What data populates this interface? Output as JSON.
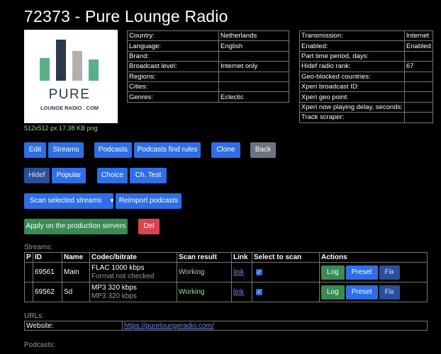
{
  "title": "72373 - Pure Lounge Radio",
  "logo": {
    "word": "PURE",
    "sub": "LOUNGE RADIO . COM",
    "colors": {
      "teal": "#5cae8a",
      "dark": "#2a3a4a",
      "grey": "#b0b0b0"
    },
    "info": "512x512 px 17.38 KB png"
  },
  "info_left": [
    {
      "k": "Country:",
      "v": "Netherlands"
    },
    {
      "k": "Language:",
      "v": "English"
    },
    {
      "k": "Brand:",
      "v": ""
    },
    {
      "k": "Broadcast level:",
      "v": "Internet only"
    },
    {
      "k": "Regions:",
      "v": ""
    },
    {
      "k": "Cities:",
      "v": ""
    },
    {
      "k": "Genres:",
      "v": "Eclectic"
    }
  ],
  "info_right": [
    {
      "k": "Transmission:",
      "v": "Internet"
    },
    {
      "k": "Enabled:",
      "v": "Enabled"
    },
    {
      "k": "Part time period, days:",
      "v": ""
    },
    {
      "k": "Hidef radio rank:",
      "v": "67"
    },
    {
      "k": "Geo-blocked countries:",
      "v": ""
    },
    {
      "k": "Xperi broadcast ID:",
      "v": ""
    },
    {
      "k": "Xperi geo point:",
      "v": ""
    },
    {
      "k": "Xperi now playing delay, seconds:",
      "v": ""
    },
    {
      "k": "Track scraper:",
      "v": ""
    }
  ],
  "buttons": {
    "edit": "Edit",
    "streams": "Streams",
    "podcasts": "Podcasts",
    "podcasts_find_rules": "Podcasts find rules",
    "clone": "Clone",
    "back": "Back",
    "hidef": "Hidef",
    "popular": "Popular",
    "choice": "Choice",
    "ch_test": "Ch. Test",
    "scan_selected": "Scan selected streams",
    "reimport": "Reimport podcasts",
    "apply": "Apply on the production servers",
    "del": "Del"
  },
  "streams": {
    "label": "Streams:",
    "headers": [
      "P",
      "ID",
      "Name",
      "Codec/bitrate",
      "Scan result",
      "Link",
      "Select to scan",
      "Actions"
    ],
    "rows": [
      {
        "p": "",
        "id": "69561",
        "name": "Main",
        "codec": "FLAC 1000 kbps",
        "codec_sub": "Format not checked",
        "scan": "Working",
        "link": "link",
        "log": "Log",
        "preset": "Preset",
        "fix": "Fix"
      },
      {
        "p": "",
        "id": "69562",
        "name": "Sd",
        "codec": "MP3 320 kbps",
        "codec_sub": "MP3 320 kbps",
        "scan": "Working",
        "link": "link",
        "log": "Log",
        "preset": "Preset",
        "fix": "Fix"
      }
    ]
  },
  "urls": {
    "label": "URLs:",
    "website_label": "Website:",
    "website": "https://pureloungeradio.com/"
  },
  "podcasts_label": "Podcasts:"
}
